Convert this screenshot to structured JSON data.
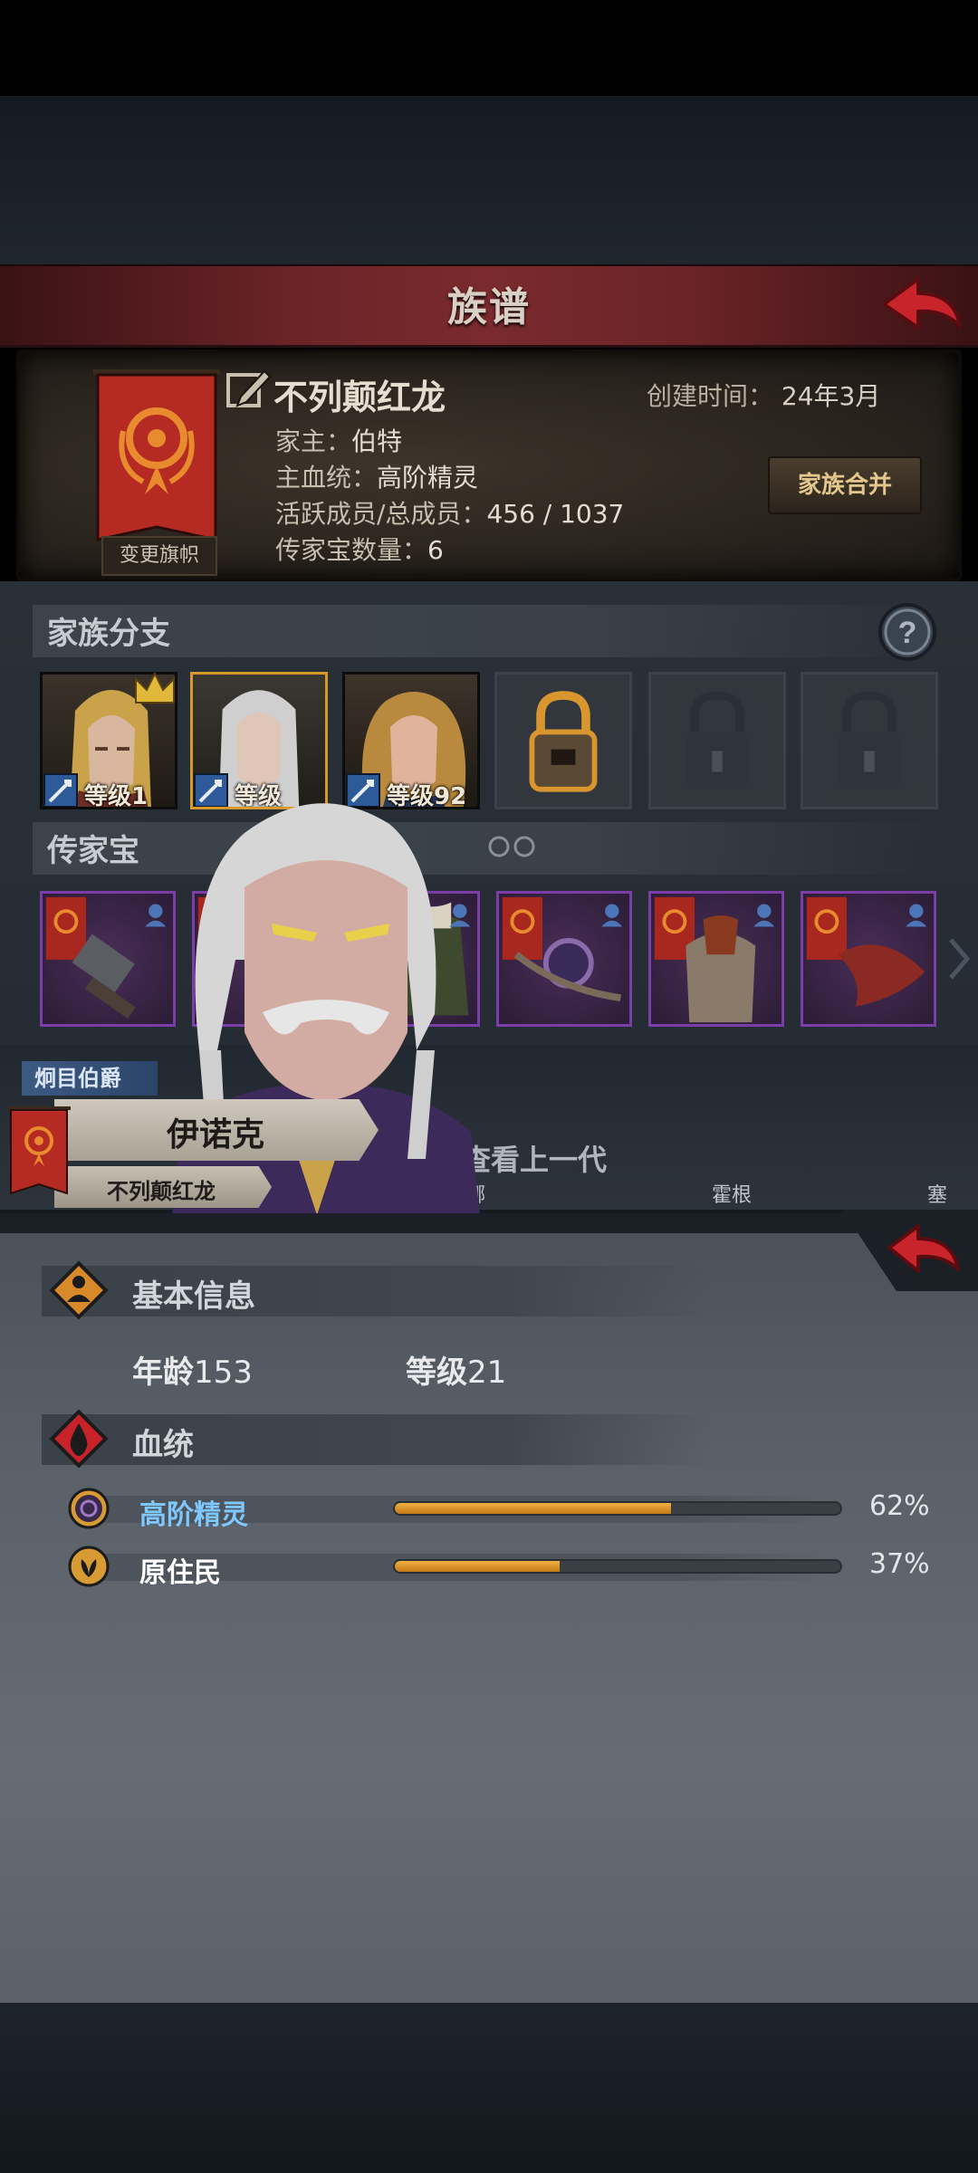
{
  "header": {
    "title": "族谱"
  },
  "family": {
    "name": "不列颠红龙",
    "created_label": "创建时间：",
    "created_value": "24年3月",
    "head_label": "家主：",
    "head_value": "伯特",
    "bloodline_label": "主血统：",
    "bloodline_value": "高阶精灵",
    "members_label": "活跃成员/总成员：",
    "members_value": "456 / 1037",
    "heirlooms_label": "传家宝数量：",
    "heirlooms_value": "6",
    "change_banner": "变更旗帜",
    "merge_button": "家族合并",
    "banner_color": "#b52a22"
  },
  "branches": {
    "title": "家族分支",
    "slots": [
      {
        "level_label": "等级1",
        "state": "portrait",
        "crown": true
      },
      {
        "level_label": "等级",
        "state": "portrait-selected"
      },
      {
        "level_label": "等级92",
        "state": "portrait"
      },
      {
        "state": "locked-gold"
      },
      {
        "state": "locked"
      },
      {
        "state": "locked"
      }
    ]
  },
  "heirlooms": {
    "title": "传家宝",
    "items": [
      "hammer",
      "cloak",
      "cloak",
      "staff",
      "armor",
      "dragon-scale"
    ],
    "border_color": "#7b3ea8"
  },
  "character": {
    "title": "炯目伯爵",
    "name": "伊诺克",
    "clan": "不列颠红龙",
    "view_previous": "查看上一代",
    "tree_names": [
      "娜",
      "霍根",
      "塞拉..."
    ]
  },
  "info": {
    "basic_title": "基本信息",
    "age_label": "年龄",
    "age_value": "153",
    "level_label": "等级",
    "level_value": "21",
    "bloodline_title": "血统",
    "bloodlines": [
      {
        "name": "高阶精灵",
        "percent": 62,
        "percent_label": "62%",
        "color": "#7ec7ff",
        "icon": "high-elf-icon"
      },
      {
        "name": "原住民",
        "percent": 37,
        "percent_label": "37%",
        "color": "#ffffff",
        "icon": "native-icon"
      }
    ]
  }
}
